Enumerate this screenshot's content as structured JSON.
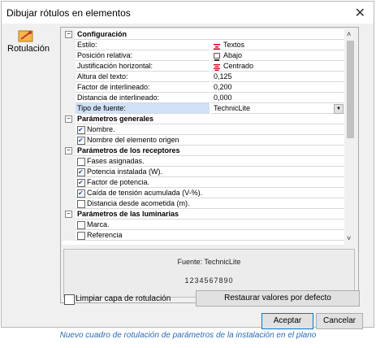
{
  "window": {
    "title": "Dibujar rótulos en elementos",
    "close_glyph": "✕"
  },
  "left_panel": {
    "label": "Rotulación",
    "icon": "rotulacion-icon"
  },
  "grid": {
    "rows": [
      {
        "kind": "cat",
        "name": "Configuración",
        "toggle": "−"
      },
      {
        "kind": "prop",
        "name": "Estilo:",
        "value": "Textos",
        "icon": "text-style-icon"
      },
      {
        "kind": "prop",
        "name": "Posición relativa:",
        "value": "Abajo",
        "icon": "position-below-icon"
      },
      {
        "kind": "prop",
        "name": "Justificación horizontal:",
        "value": "Centrado",
        "icon": "center-justify-icon"
      },
      {
        "kind": "prop",
        "name": "Altura del texto:",
        "value": "0,125"
      },
      {
        "kind": "prop",
        "name": "Factor de interlineado:",
        "value": "0,200"
      },
      {
        "kind": "prop",
        "name": "Distancia de interlineado:",
        "value": "0,000"
      },
      {
        "kind": "prop",
        "name": "Tipo de fuente:",
        "value": "TechnicLite",
        "selected": true,
        "dropdown": true
      },
      {
        "kind": "cat",
        "name": "Parámetros generales",
        "toggle": "−"
      },
      {
        "kind": "check",
        "name": "Nombre.",
        "checked": true
      },
      {
        "kind": "check",
        "name": "Nombre del elemento origen",
        "checked": true
      },
      {
        "kind": "cat",
        "name": "Parámetros de los receptores",
        "toggle": "−"
      },
      {
        "kind": "check",
        "name": "Fases asignadas.",
        "checked": false
      },
      {
        "kind": "check",
        "name": "Potencia instalada (W).",
        "checked": true
      },
      {
        "kind": "check",
        "name": "Factor de potencia.",
        "checked": true
      },
      {
        "kind": "check",
        "name": "Caída de tensión acumulada (V-%).",
        "checked": true
      },
      {
        "kind": "check",
        "name": "Distancia desde acometida (m).",
        "checked": false
      },
      {
        "kind": "cat",
        "name": "Parámetros de las luminarias",
        "toggle": "−"
      },
      {
        "kind": "check",
        "name": "Marca.",
        "checked": false
      },
      {
        "kind": "check",
        "name": "Referencia",
        "checked": false
      }
    ],
    "scroll_up": "˄",
    "scroll_down": "˅"
  },
  "preview": {
    "font_line": "Fuente: TechnicLite",
    "sample": "1234567890"
  },
  "clear_layer": {
    "label": "Limpiar capa de rotulación",
    "checked": false
  },
  "buttons": {
    "restore": "Restaurar valores por defecto",
    "accept": "Aceptar",
    "cancel": "Cancelar"
  },
  "caption": "Nuevo cuadro de rotulación de parámetros de la instalación en el plano",
  "colors": {
    "selected_row": "#cfe0f7",
    "caption": "#2e6ab1",
    "accept_border": "#0078d7",
    "text_style_red": "#d0021b"
  }
}
